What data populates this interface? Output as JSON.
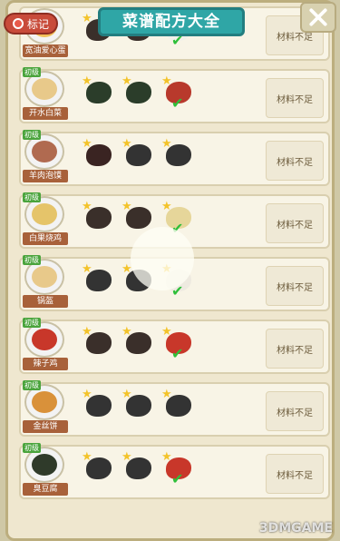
{
  "header": {
    "title": "菜谱配方大全",
    "marker_label": "标记"
  },
  "colors": {
    "accent": "#2fa6a6",
    "marker": "#c84b3a",
    "complete": "#2fbf3a"
  },
  "recipes": [
    {
      "name": "宽油爱心蛋",
      "badge": "",
      "food_color": "#f2c15a",
      "ing_colors": [
        "#3a2f2a",
        "#3a2f2a",
        "#f1f1ea"
      ],
      "check": true,
      "status": "材料不足"
    },
    {
      "name": "开水白菜",
      "badge": "初级",
      "food_color": "#e8c98a",
      "ing_colors": [
        "#2b3d2a",
        "#2b3d2a",
        "#b8392c"
      ],
      "check": true,
      "status": "材料不足"
    },
    {
      "name": "羊肉泡馍",
      "badge": "初级",
      "food_color": "#b06a50",
      "ing_colors": [
        "#3a2422",
        "#333",
        "#333"
      ],
      "check": false,
      "status": "材料不足"
    },
    {
      "name": "白果烧鸡",
      "badge": "初级",
      "food_color": "#e5c46a",
      "ing_colors": [
        "#3a2f2a",
        "#3a2f2a",
        "#e6d69a"
      ],
      "check": true,
      "status": "材料不足"
    },
    {
      "name": "锅盔",
      "badge": "初级",
      "food_color": "#e8c98a",
      "ing_colors": [
        "#333",
        "#333",
        "#eeeae0"
      ],
      "check": true,
      "status": "材料不足"
    },
    {
      "name": "辣子鸡",
      "badge": "初级",
      "food_color": "#c8372a",
      "ing_colors": [
        "#3a2f2a",
        "#3a2f2a",
        "#c8372a"
      ],
      "check": true,
      "status": "材料不足"
    },
    {
      "name": "金丝饼",
      "badge": "初级",
      "food_color": "#d9913a",
      "ing_colors": [
        "#333",
        "#333",
        "#333"
      ],
      "check": false,
      "status": "材料不足"
    },
    {
      "name": "臭豆腐",
      "badge": "初级",
      "food_color": "#2f3a2a",
      "ing_colors": [
        "#333",
        "#333",
        "#c8372a"
      ],
      "check": true,
      "status": "材料不足"
    }
  ],
  "watermark": "3DMGAME"
}
